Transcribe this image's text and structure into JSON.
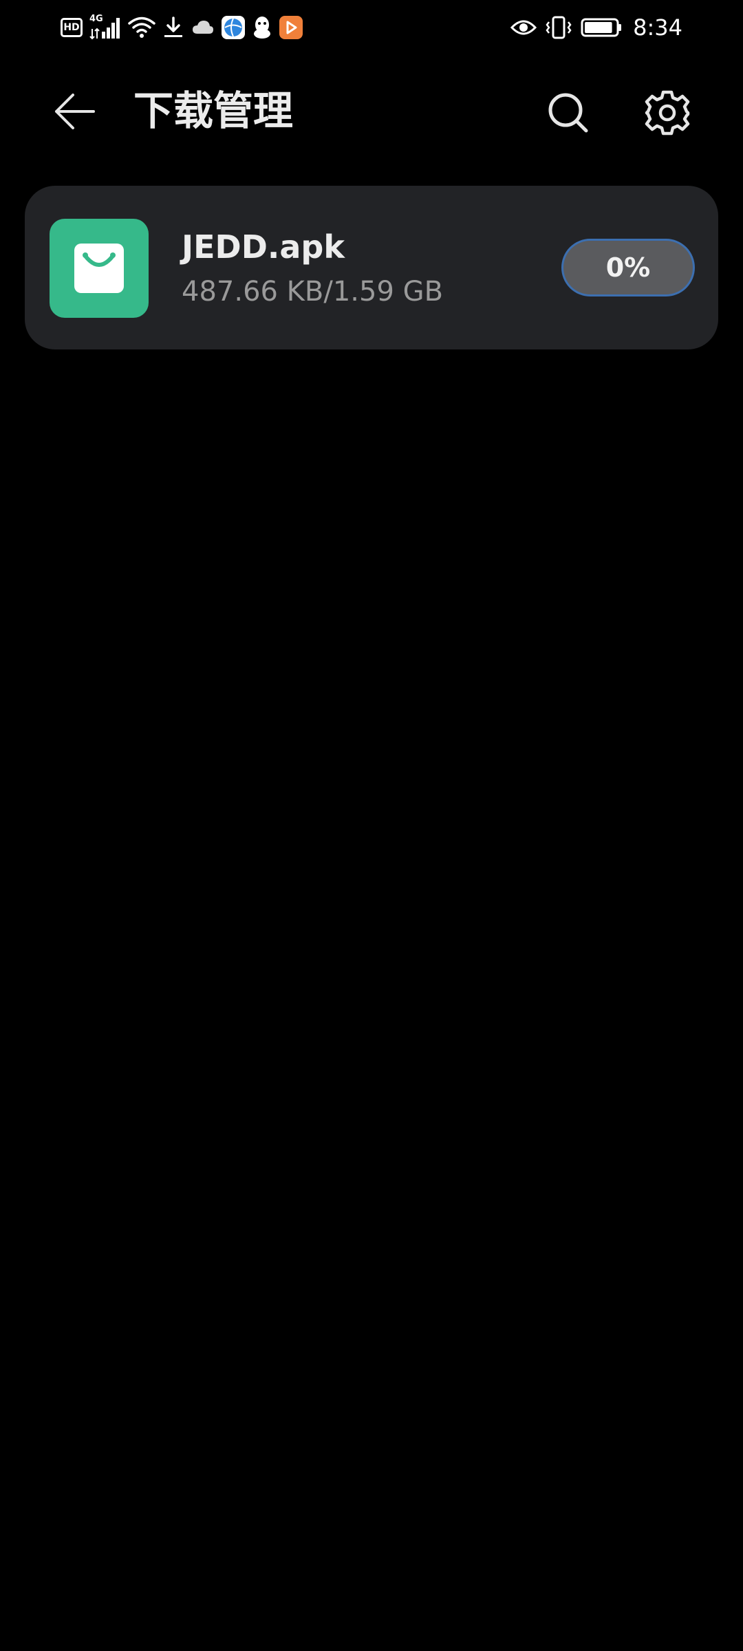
{
  "status_bar": {
    "left_icons": [
      "hd-icon",
      "4g-signal-icon",
      "wifi-icon",
      "download-icon",
      "cloud-icon",
      "browser-app-icon",
      "qq-penguin-icon",
      "video-app-icon"
    ],
    "hd_label": "HD",
    "network_label": "4G",
    "right_icons": [
      "eye-icon",
      "vibrate-icon",
      "battery-icon"
    ],
    "battery_level": 0.9,
    "time": "8:34"
  },
  "app_bar": {
    "title": "下载管理",
    "actions": [
      "back-arrow-icon",
      "search-icon",
      "gear-icon"
    ]
  },
  "downloads": [
    {
      "file_name": "JEDD.apk",
      "size_text": "487.66 KB/1.59 GB",
      "progress_label": "0%",
      "progress": 0,
      "icon": "shopping-bag-icon",
      "icon_color": "#36b98a"
    }
  ],
  "colors": {
    "background": "#000000",
    "card": "#222326",
    "accent": "#3c6fb0",
    "secondary_text": "#9a9a9a"
  }
}
